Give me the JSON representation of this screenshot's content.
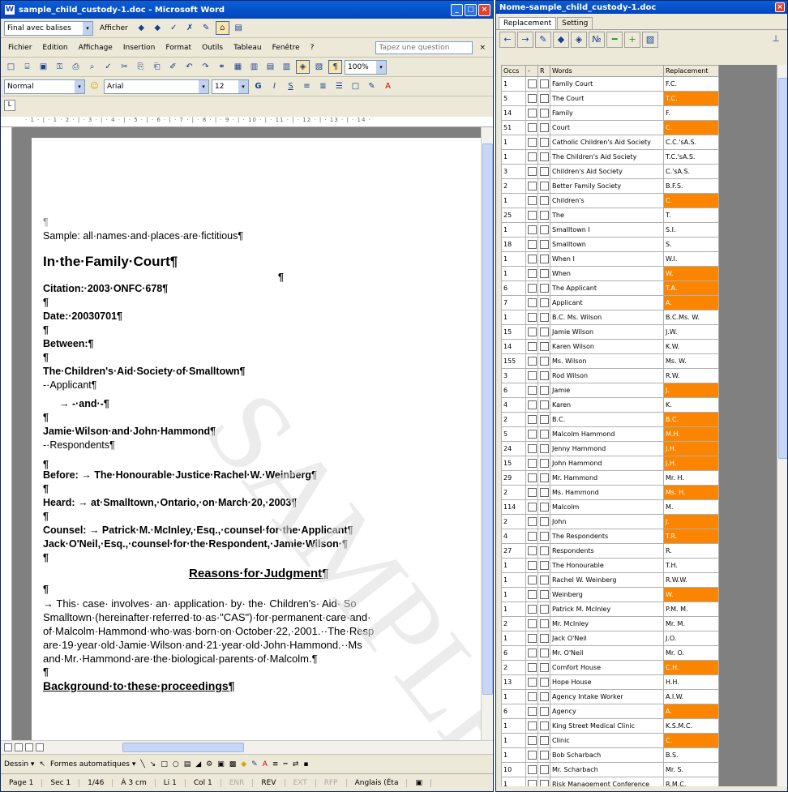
{
  "word": {
    "title": "sample_child_custody-1.doc - Microsoft Word",
    "review_mode": "Final avec balises",
    "show_menu": "Afficher",
    "menu": [
      "Fichier",
      "Edition",
      "Affichage",
      "Insertion",
      "Format",
      "Outils",
      "Tableau",
      "Fenêtre",
      "?"
    ],
    "ask_placeholder": "Tapez une question",
    "zoom": "100%",
    "style": "Normal",
    "font": "Arial",
    "size": "12",
    "ruler_text": "· 1 · | · 1 · 2 · | · 3 · | · 4 · | · 5 · | · 6 · | · 7 · | · 8 · | · 9 · | · 10 · | · 11 · | · 12 · | · 13 · | · 14 ·",
    "document": {
      "para1": "¶",
      "sample_note": "Sample: all·names·and·places·are·fictitious¶",
      "court_title": "In·the·Family·Court¶",
      "pilcrow_center": "¶",
      "citation": "Citation:·2003·ONFC·678¶",
      "date": "Date:·20030701¶",
      "between": "Between:¶",
      "applicant_name": "The·Children's·Aid·Society·of·Smalltown¶",
      "applicant_label": "-·Applicant¶",
      "and": "→   -·and·-¶",
      "respondents_name": "Jamie·Wilson·and·John·Hammond¶",
      "respondents_label": "-·Respondents¶",
      "before": "Before:  →   The·Honourable·Justice·Rachel·W.·Weinberg¶",
      "heard": "Heard:  →   at·Smalltown,·Ontario,·on·March·20,·2003¶",
      "counsel1": "Counsel: → Patrick·M.·McInley,·Esq.,·counsel·for·the·Applicant¶",
      "counsel2": "Jack·O'Neil,·Esq.,·counsel·for·the·Respondent,·Jamie·Wilson·¶",
      "reasons": "Reasons·for·Judgment¶",
      "body1": "  →   This· case· involves· an· application· by· the· Children's· Aid· So",
      "body2": "Smalltown·(hereinafter·referred·to·as·\"CAS\")·for·permanent·care·and·",
      "body3": "of·Malcolm·Hammond·who·was·born·on·October·22,·2001.··The·Resp",
      "body4": "are·19·year·old·Jamie·Wilson·and·21·year·old·John·Hammond.··Ms",
      "body5": "and·Mr.·Hammond·are·the·biological·parents·of·Malcolm.¶",
      "background": "Background·to·these·proceedings¶",
      "watermark": "SAMPLE"
    },
    "draw": {
      "dessin": "Dessin ▾",
      "shapes": "Formes automatiques ▾"
    },
    "status": {
      "page": "Page 1",
      "sec": "Sec 1",
      "pages": "1/46",
      "at": "À 3 cm",
      "line": "Li 1",
      "col": "Col 1",
      "enr": "ENR",
      "rev": "REV",
      "ext": "EXT",
      "rfp": "RFP",
      "lang": "Anglais (Éta"
    }
  },
  "replacement": {
    "title": "Nome-sample_child_custody-1.doc",
    "tabs": [
      "Replacement",
      "Setting"
    ],
    "headers": [
      "Occs",
      "-",
      "R",
      "Words",
      "Replacement"
    ],
    "rows": [
      [
        "1",
        "Family Court",
        "F.C.",
        false
      ],
      [
        "5",
        "The Court",
        "T.C.",
        true
      ],
      [
        "14",
        "Family",
        "F.",
        false
      ],
      [
        "51",
        "Court",
        "C.",
        true
      ],
      [
        "1",
        "Catholic Children's Aid Society",
        "C.C.'sA.S.",
        false
      ],
      [
        "1",
        "The Children's Aid Society",
        "T.C.'sA.S.",
        false
      ],
      [
        "3",
        "Children's Aid Society",
        "C.'sA.S.",
        false
      ],
      [
        "2",
        "Better Family Society",
        "B.F.S.",
        false
      ],
      [
        "1",
        "Children's",
        "C.",
        true
      ],
      [
        "25",
        "The",
        "T.",
        false
      ],
      [
        "1",
        "Smalltown I",
        "S.I.",
        false
      ],
      [
        "18",
        "Smalltown",
        "S.",
        false
      ],
      [
        "1",
        "When I",
        "W.I.",
        false
      ],
      [
        "1",
        "When",
        "W.",
        true
      ],
      [
        "6",
        "The Applicant",
        "T.A.",
        true
      ],
      [
        "7",
        "Applicant",
        "A.",
        true
      ],
      [
        "1",
        "B.C.   Ms. Wilson",
        "B.C.Ms. W.",
        false
      ],
      [
        "15",
        "Jamie Wilson",
        "J.W.",
        false
      ],
      [
        "14",
        "Karen Wilson",
        "K.W.",
        false
      ],
      [
        "155",
        "Ms. Wilson",
        "Ms. W.",
        false
      ],
      [
        "3",
        "Rod Wilson",
        "R.W.",
        false
      ],
      [
        "6",
        "Jamie",
        "J.",
        true
      ],
      [
        "4",
        "Karen",
        "K.",
        false
      ],
      [
        "2",
        "B.C.",
        "B.C.",
        true
      ],
      [
        "5",
        "Malcolm Hammond",
        "M.H.",
        true
      ],
      [
        "24",
        "Jenny Hammond",
        "J.H.",
        true
      ],
      [
        "15",
        "John Hammond",
        "J.H.",
        true
      ],
      [
        "29",
        "Mr. Hammond",
        "Mr. H.",
        false
      ],
      [
        "2",
        "Ms. Hammond",
        "Ms. H.",
        true
      ],
      [
        "114",
        "Malcolm",
        "M.",
        false
      ],
      [
        "2",
        "John",
        "J.",
        true
      ],
      [
        "4",
        "The Respondents",
        "T.R.",
        true
      ],
      [
        "27",
        "Respondents",
        "R.",
        false
      ],
      [
        "1",
        "The Honourable",
        "T.H.",
        false
      ],
      [
        "1",
        "Rachel W. Weinberg",
        "R.W.W.",
        false
      ],
      [
        "1",
        "Weinberg",
        "W.",
        true
      ],
      [
        "1",
        "Patrick M. McInley",
        "P.M. M.",
        false
      ],
      [
        "2",
        "Mr. McInley",
        "Mr. M.",
        false
      ],
      [
        "1",
        "Jack O'Neil",
        "J.O.",
        false
      ],
      [
        "6",
        "Mr. O'Neil",
        "Mr. O.",
        false
      ],
      [
        "2",
        "Comfort House",
        "C.H.",
        true
      ],
      [
        "13",
        "Hope House",
        "H.H.",
        false
      ],
      [
        "1",
        "Agency Intake Worker",
        "A.I.W.",
        false
      ],
      [
        "6",
        "Agency",
        "A.",
        true
      ],
      [
        "1",
        "King Street Medical Clinic",
        "K.S.M.C.",
        false
      ],
      [
        "1",
        "Clinic",
        "C.",
        true
      ],
      [
        "1",
        "Bob Scharbach",
        "B.S.",
        false
      ],
      [
        "10",
        "Mr. Scharbach",
        "Mr. S.",
        false
      ],
      [
        "1",
        "Risk Management Conference",
        "R.M.C.",
        false
      ]
    ],
    "highlight_color": "#fb8400"
  }
}
